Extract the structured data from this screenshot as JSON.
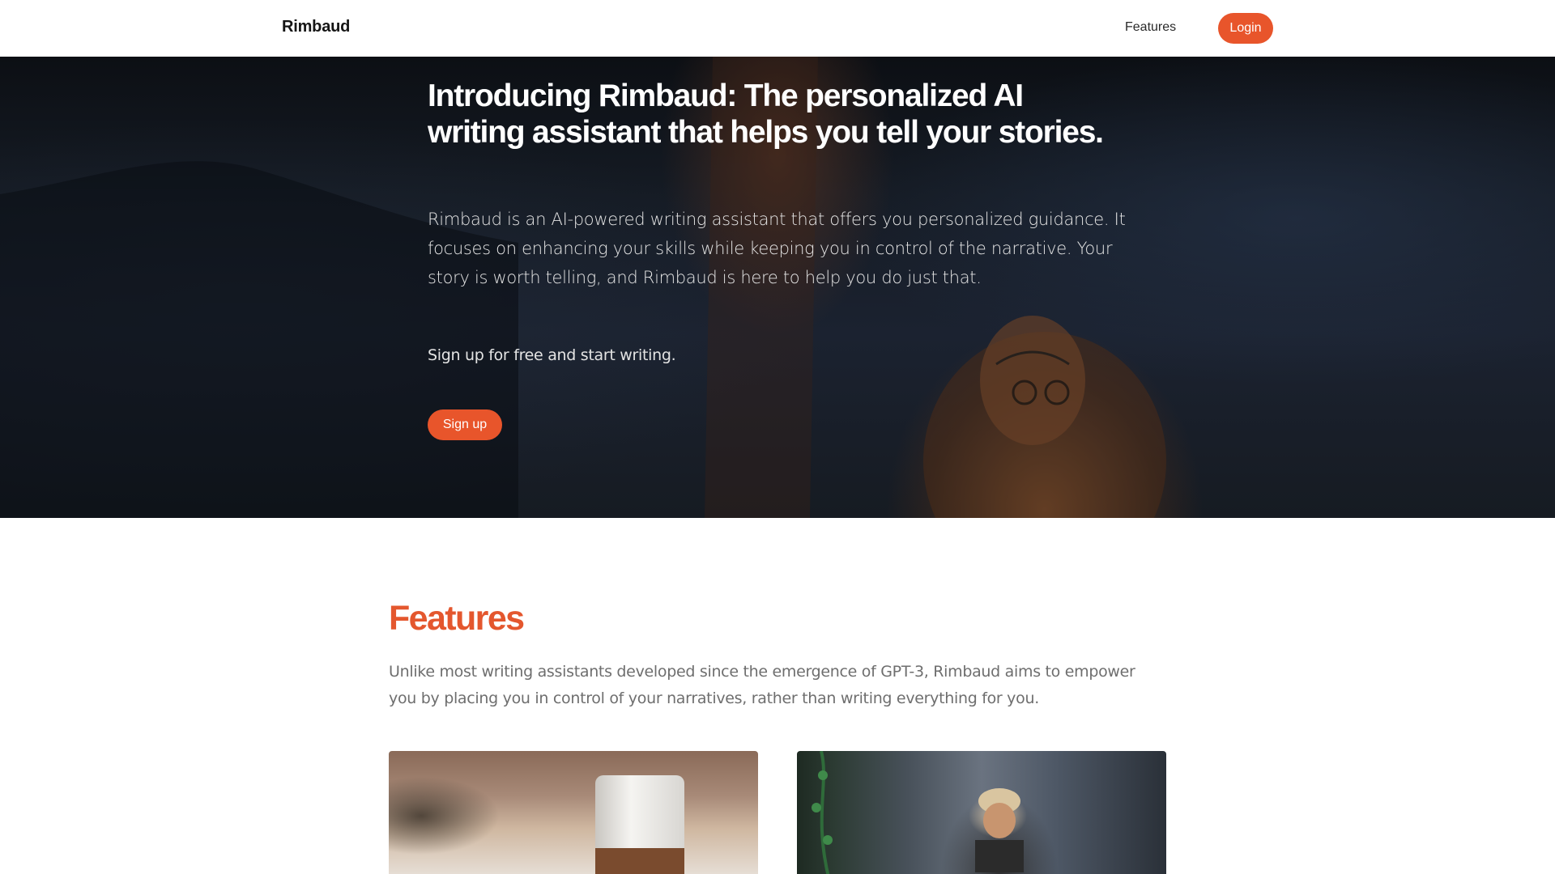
{
  "header": {
    "brand": "Rimbaud",
    "nav": {
      "features_label": "Features",
      "login_label": "Login"
    }
  },
  "hero": {
    "title": "Introducing Rimbaud: The personalized AI writing assistant that helps you tell your stories.",
    "description": "Rimbaud is an AI-powered writing assistant that offers you personalized guidance. It focuses on enhancing your skills while keeping you in control of the narrative. Your story is worth telling, and Rimbaud is here to help you do just that.",
    "cta_text": "Sign up for free and start writing.",
    "signup_label": "Sign up"
  },
  "features": {
    "title": "Features",
    "description": "Unlike most writing assistants developed since the emergence of GPT-3, Rimbaud aims to empower you by placing you in control of your narratives, rather than writing everything for you."
  },
  "colors": {
    "accent": "#e8552b",
    "features_title": "#e4572e",
    "hero_background": "#151b24"
  }
}
